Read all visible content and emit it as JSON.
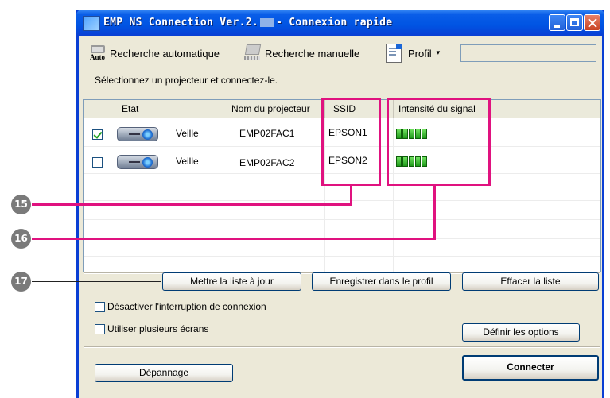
{
  "window": {
    "title_prefix": "EMP NS Connection Ver.2.",
    "title_suffix": "- Connexion rapide"
  },
  "toolbar": {
    "auto_icon_text": "Auto",
    "auto_search_label": "Recherche automatique",
    "manual_search_label": "Recherche manuelle",
    "profile_label": "Profil",
    "profile_arrow": "▾"
  },
  "instruction": "Sélectionnez un projecteur et connectez-le.",
  "list": {
    "columns": [
      "Etat",
      "Nom du projecteur",
      "SSID",
      "Intensité du signal"
    ],
    "rows": [
      {
        "checked": true,
        "state": "Veille",
        "name": "EMP02FAC1",
        "ssid": "EPSON1",
        "signal_bars": 5
      },
      {
        "checked": false,
        "state": "Veille",
        "name": "EMP02FAC2",
        "ssid": "EPSON2",
        "signal_bars": 5
      }
    ]
  },
  "callouts": [
    "15",
    "16",
    "17"
  ],
  "buttons": {
    "update_list": "Mettre la liste à jour",
    "save_profile": "Enregistrer dans le profil",
    "clear_list": "Effacer la liste",
    "set_options": "Définir les options",
    "troubleshoot": "Dépannage",
    "connect": "Connecter"
  },
  "options": {
    "disable_interrupt": "Désactiver l'interruption de connexion",
    "multi_screen": "Utiliser plusieurs écrans"
  },
  "colors": {
    "highlight": "#e0127f",
    "titlebar": "#0054e3",
    "window_bg": "#ece9d8"
  }
}
